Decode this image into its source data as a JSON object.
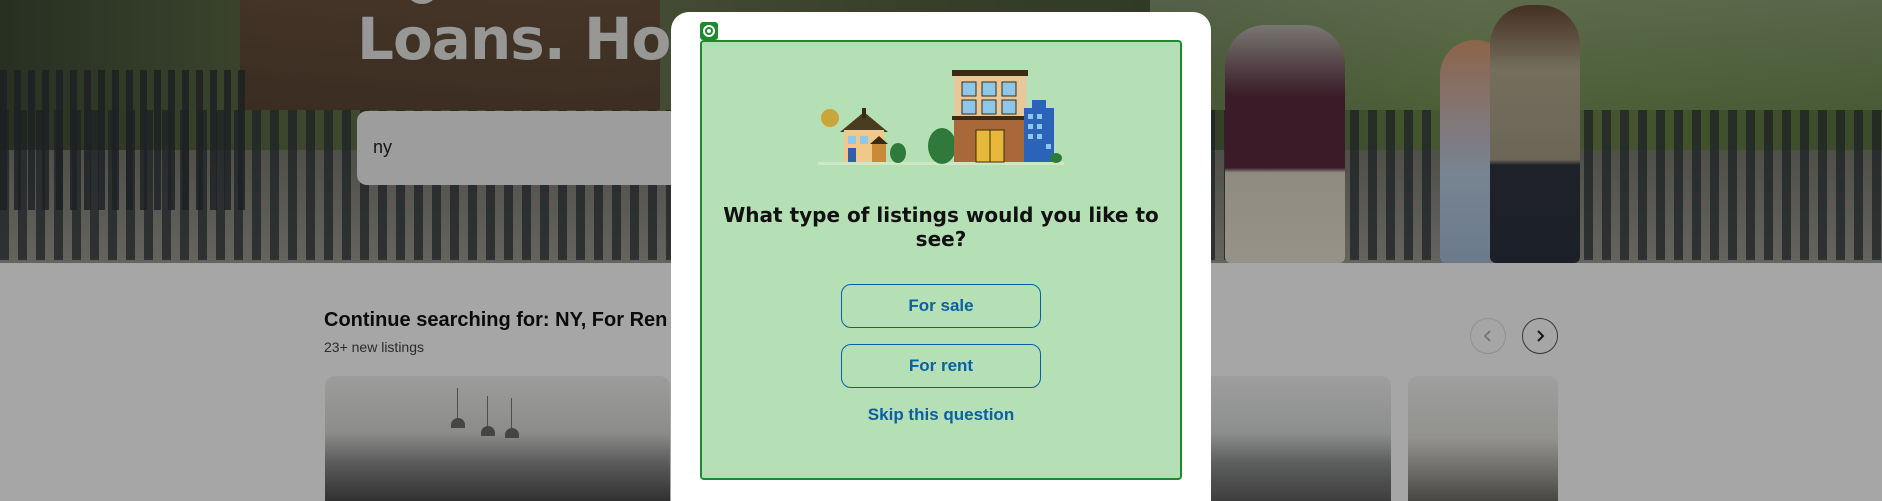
{
  "hero": {
    "title": "Loans. Hor",
    "search_value": "ny"
  },
  "continue_section": {
    "title": "Continue searching for: NY, For Ren",
    "subtitle": "23+ new listings",
    "prev_icon": "chevron-left-icon",
    "next_icon": "chevron-right-icon"
  },
  "modal": {
    "question": "What type of listings would you like to see?",
    "options": [
      {
        "label": "For sale"
      },
      {
        "label": "For rent"
      }
    ],
    "skip_label": "Skip this question",
    "highlight_color": "#1e8a2e",
    "highlight_fill": "#b5dfb5",
    "link_color": "#0b5fa4"
  }
}
